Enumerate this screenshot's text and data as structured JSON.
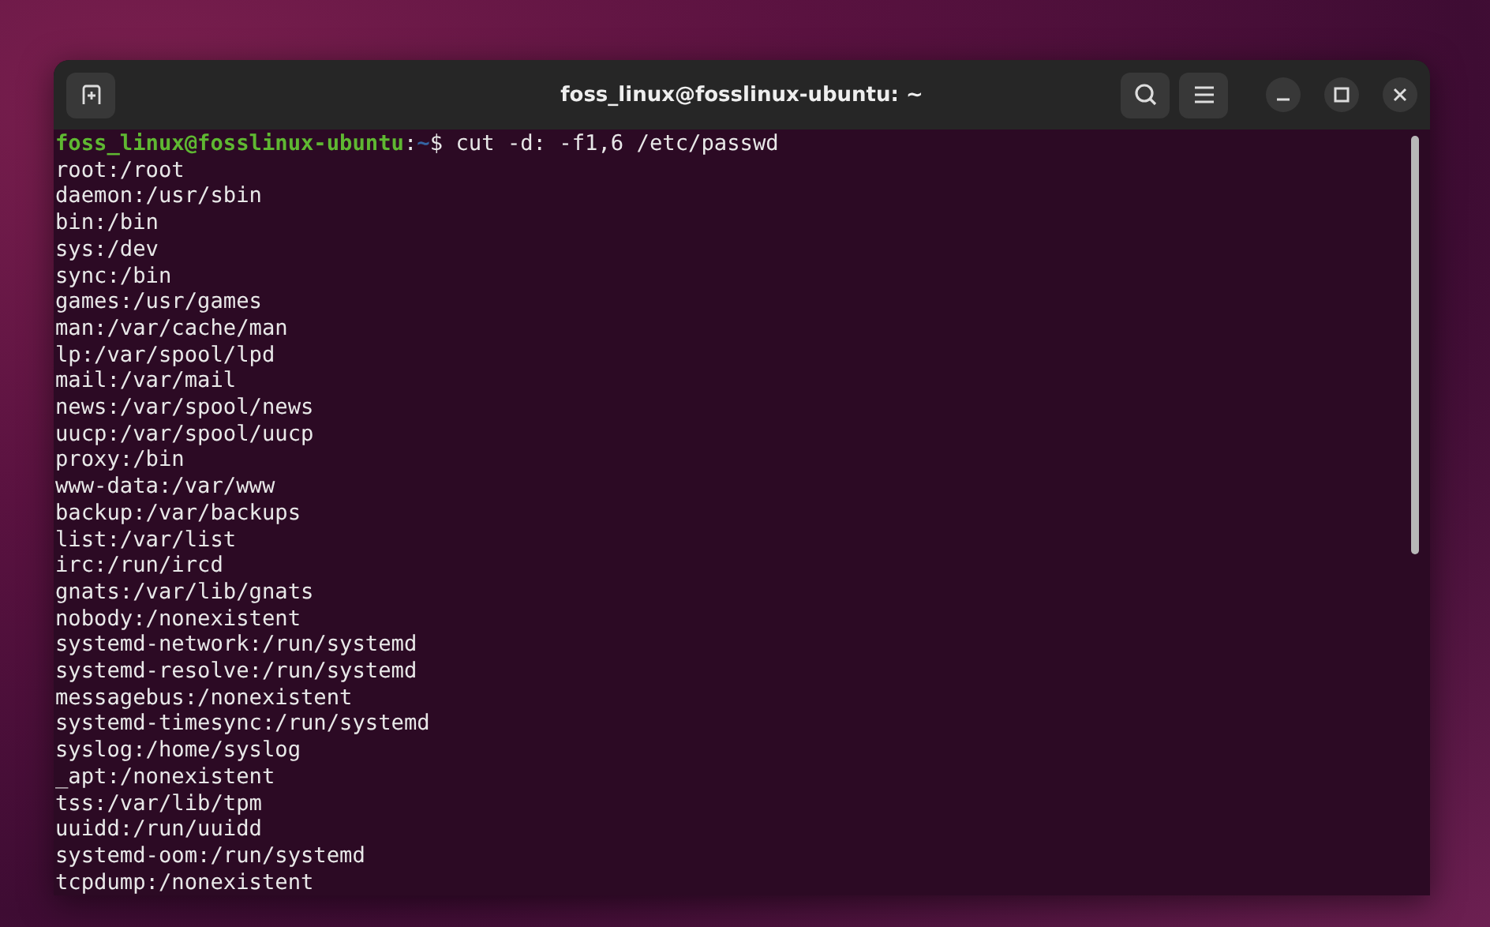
{
  "window": {
    "title": "foss_linux@fosslinux-ubuntu: ~"
  },
  "prompt": {
    "user_host": "foss_linux@fosslinux-ubuntu",
    "separator": ":",
    "path": "~",
    "symbol": "$",
    "command": "cut -d: -f1,6 /etc/passwd"
  },
  "output": [
    "root:/root",
    "daemon:/usr/sbin",
    "bin:/bin",
    "sys:/dev",
    "sync:/bin",
    "games:/usr/games",
    "man:/var/cache/man",
    "lp:/var/spool/lpd",
    "mail:/var/mail",
    "news:/var/spool/news",
    "uucp:/var/spool/uucp",
    "proxy:/bin",
    "www-data:/var/www",
    "backup:/var/backups",
    "list:/var/list",
    "irc:/run/ircd",
    "gnats:/var/lib/gnats",
    "nobody:/nonexistent",
    "systemd-network:/run/systemd",
    "systemd-resolve:/run/systemd",
    "messagebus:/nonexistent",
    "systemd-timesync:/run/systemd",
    "syslog:/home/syslog",
    "_apt:/nonexistent",
    "tss:/var/lib/tpm",
    "uuidd:/run/uuidd",
    "systemd-oom:/run/systemd",
    "tcpdump:/nonexistent"
  ]
}
